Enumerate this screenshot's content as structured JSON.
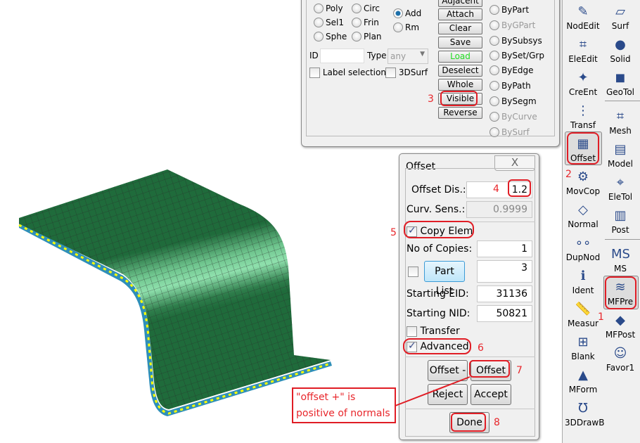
{
  "select_panel": {
    "radios_col1": [
      "Poly",
      "Sel1",
      "Sphe"
    ],
    "radios_col2": [
      "Circ",
      "Frin",
      "Plan"
    ],
    "mode": {
      "add": "Add",
      "rm": "Rm",
      "selected": "Add"
    },
    "buttons": [
      "Adjacent",
      "Attach",
      "Clear",
      "Save",
      "Load",
      "Deselect",
      "Whole",
      "Visible",
      "Reverse"
    ],
    "by_options": [
      "ByPart",
      "ByGPart",
      "BySubsys",
      "BySet/Grp",
      "ByEdge",
      "ByPath",
      "BySegm",
      "ByCurve",
      "BySurf"
    ],
    "id_label": "ID",
    "id_value": "",
    "type_label": "Type",
    "type_value": "any",
    "label_selection": "Label selection",
    "surf3d": "3DSurf",
    "load_color": "#22dd22"
  },
  "offset_dialog": {
    "title": "Offset",
    "close": "X",
    "offset_dis_label": "Offset Dis.:",
    "offset_dis": "1.2",
    "curv_sens_label": "Curv. Sens.:",
    "curv_sens": "0.9999",
    "copy_elem": "Copy Elem",
    "copy_elem_checked": true,
    "no_copies_label": "No of Copies:",
    "no_copies": "1",
    "part_list": "Part List",
    "part_list_checked": false,
    "part_value": "3",
    "start_eid_label": "Starting EID:",
    "start_eid": "31136",
    "start_nid_label": "Starting NID:",
    "start_nid": "50821",
    "transfer": "Transfer",
    "transfer_checked": false,
    "advanced": "Advanced",
    "advanced_checked": true,
    "offset_minus": "Offset -",
    "offset_plus": "Offset +",
    "reject": "Reject",
    "accept": "Accept",
    "done": "Done"
  },
  "toolbar": {
    "left": [
      "NodEdit",
      "EleEdit",
      "CreEnt",
      "Transf",
      "Offset",
      "MovCop",
      "Normal",
      "DupNod",
      "Ident",
      "Measur",
      "Blank",
      "MForm",
      "3DDrawB"
    ],
    "right": [
      "Surf",
      "Solid",
      "GeoTol",
      "Mesh",
      "Model",
      "EleTol",
      "Post",
      "MS",
      "MFPre",
      "MFPost",
      "Favor1"
    ]
  },
  "annotations": {
    "n1": "1",
    "n2": "2",
    "n3": "3",
    "n4": "4",
    "n5": "5",
    "n6": "6",
    "n7": "7",
    "n8": "8",
    "callout_line1": "\"offset +\" is",
    "callout_line2": "positive of normals",
    "color": "#e01d25"
  },
  "mesh_colors": {
    "dark": "#1f6b3b",
    "light": "#8fe0ad",
    "edge": "#2f8fb8",
    "marker": "#ffff00"
  }
}
